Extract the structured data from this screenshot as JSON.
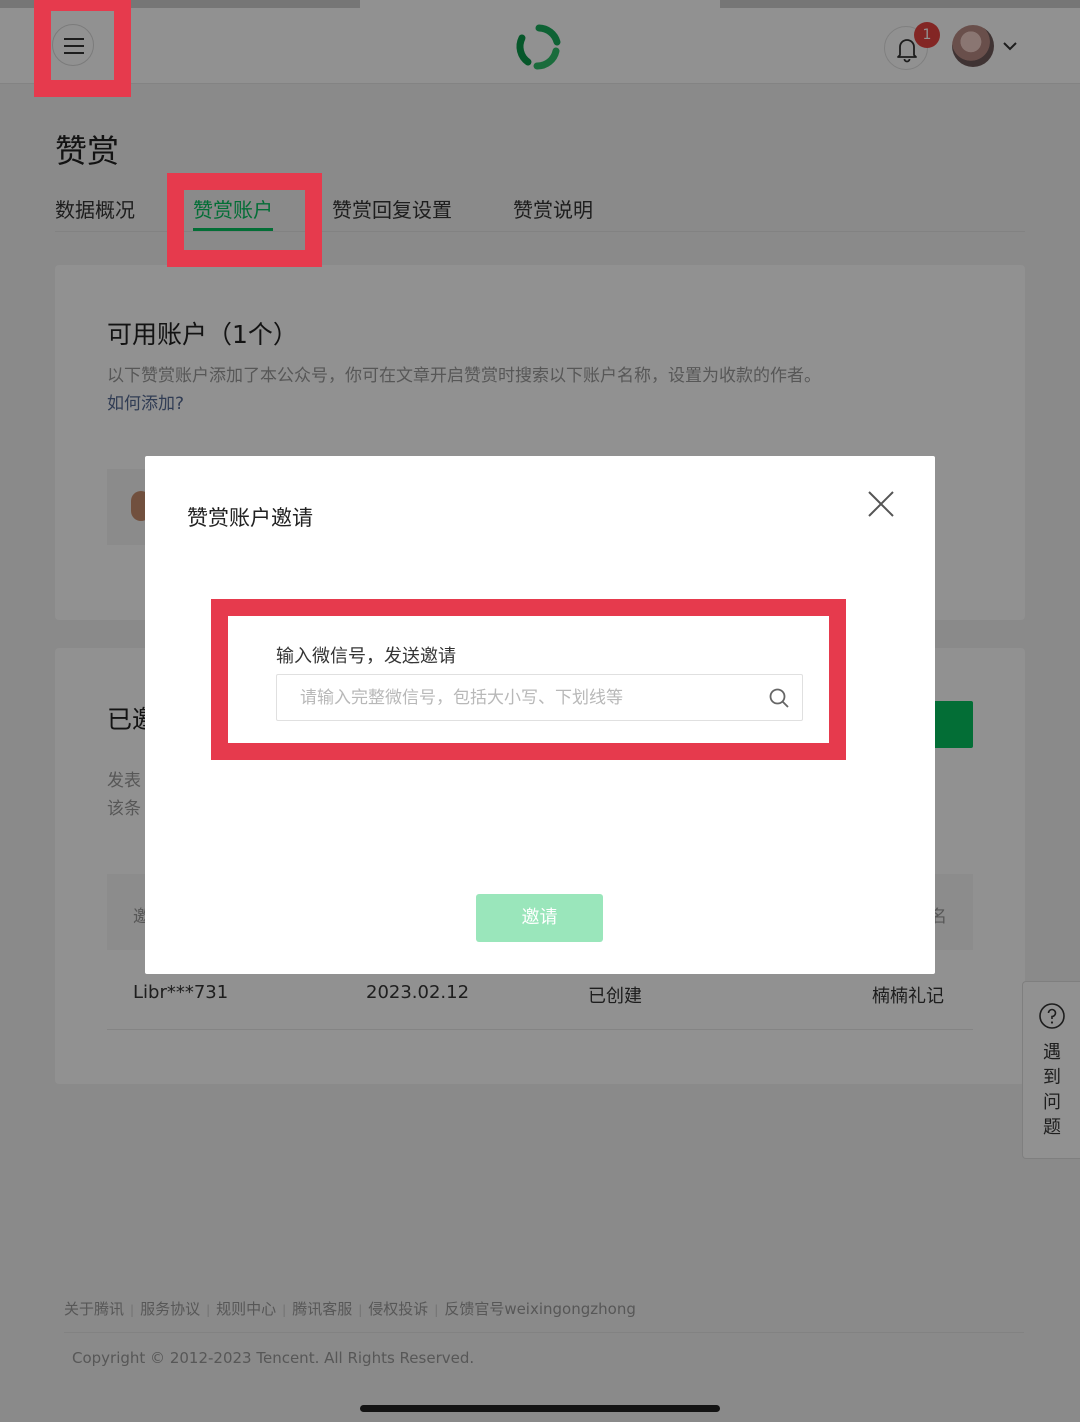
{
  "header": {
    "notification_count": "1"
  },
  "page": {
    "title": "赞赏",
    "tabs": [
      {
        "label": "数据概况",
        "active": false
      },
      {
        "label": "赞赏账户",
        "active": true
      },
      {
        "label": "赞赏回复设置",
        "active": false
      },
      {
        "label": "赞赏说明",
        "active": false
      }
    ]
  },
  "accounts_card": {
    "title": "可用账户（1个）",
    "description": "以下赞赏账户添加了本公众号，你可在文章开启赞赏时搜索以下账户名称，设置为收款的作者。",
    "how_to_add_link": "如何添加?"
  },
  "invited_card": {
    "title_partial": "已邀",
    "desc_line1_partial": "发表",
    "desc_line2_partial": "该条",
    "table": {
      "header_left_partial": "邀",
      "header_right_partial": "名",
      "rows": [
        {
          "wechat_id": "Libr***731",
          "date": "2023.02.12",
          "status": "已创建",
          "name": "楠楠礼记"
        }
      ]
    }
  },
  "dialog": {
    "title": "赞赏账户邀请",
    "field_label": "输入微信号，发送邀请",
    "input_value": "",
    "input_placeholder": "请输入完整微信号，包括大小写、下划线等",
    "invite_button": "邀请"
  },
  "footer": {
    "links": [
      "关于腾讯",
      "服务协议",
      "规则中心",
      "腾讯客服",
      "侵权投诉",
      "反馈官号weixingongzhong"
    ],
    "copyright": "Copyright © 2012-2023 Tencent. All Rights Reserved."
  },
  "help_float": {
    "label": "遇到问题"
  },
  "colors": {
    "brand_green": "#07c160",
    "link_blue": "#576b95",
    "badge_red": "#e64340",
    "annotation_red": "#e63a4d",
    "disabled_green": "#9ae6bb"
  },
  "icons": [
    "hamburger-menu-icon",
    "wechat-mp-logo-icon",
    "bell-icon",
    "chevron-down-icon",
    "close-icon",
    "search-icon",
    "help-circle-icon"
  ]
}
